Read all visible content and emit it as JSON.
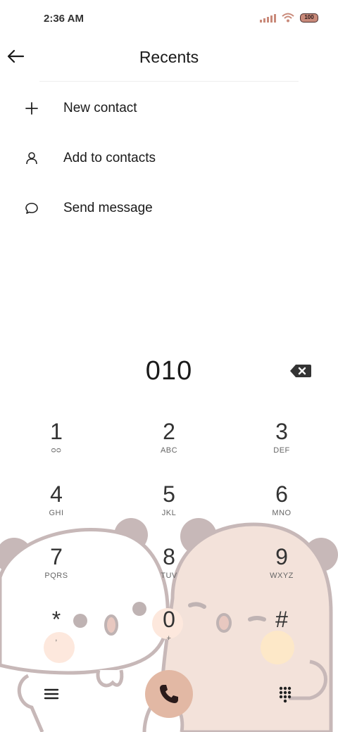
{
  "status_bar": {
    "time": "2:36 AM",
    "battery": "100",
    "icons": [
      "signal-icon",
      "wifi-icon",
      "battery-icon"
    ]
  },
  "header": {
    "title": "Recents",
    "back_icon": "back-arrow-icon"
  },
  "actions": [
    {
      "icon": "plus-icon",
      "label": "New contact"
    },
    {
      "icon": "person-icon",
      "label": "Add to contacts"
    },
    {
      "icon": "chat-bubble-icon",
      "label": "Send message"
    }
  ],
  "dialer": {
    "number": "010",
    "keys": [
      {
        "digit": "1",
        "letters": "ᴑᴑ"
      },
      {
        "digit": "2",
        "letters": "ABC"
      },
      {
        "digit": "3",
        "letters": "DEF"
      },
      {
        "digit": "4",
        "letters": "GHI"
      },
      {
        "digit": "5",
        "letters": "JKL"
      },
      {
        "digit": "6",
        "letters": "MNO"
      },
      {
        "digit": "7",
        "letters": "PQRS"
      },
      {
        "digit": "8",
        "letters": "TUV"
      },
      {
        "digit": "9",
        "letters": "WXYZ"
      },
      {
        "digit": "*",
        "letters": ","
      },
      {
        "digit": "0",
        "letters": "+"
      },
      {
        "digit": "#",
        "letters": ""
      }
    ]
  },
  "bottom_bar": {
    "icons": [
      "menu-icon",
      "phone-icon",
      "keypad-icon"
    ]
  },
  "colors": {
    "accent": "#e2b8a4",
    "bear_outline": "#bfb3b3",
    "bear_fill_pink": "#f3e2da",
    "cheek": "#fde8dd"
  }
}
